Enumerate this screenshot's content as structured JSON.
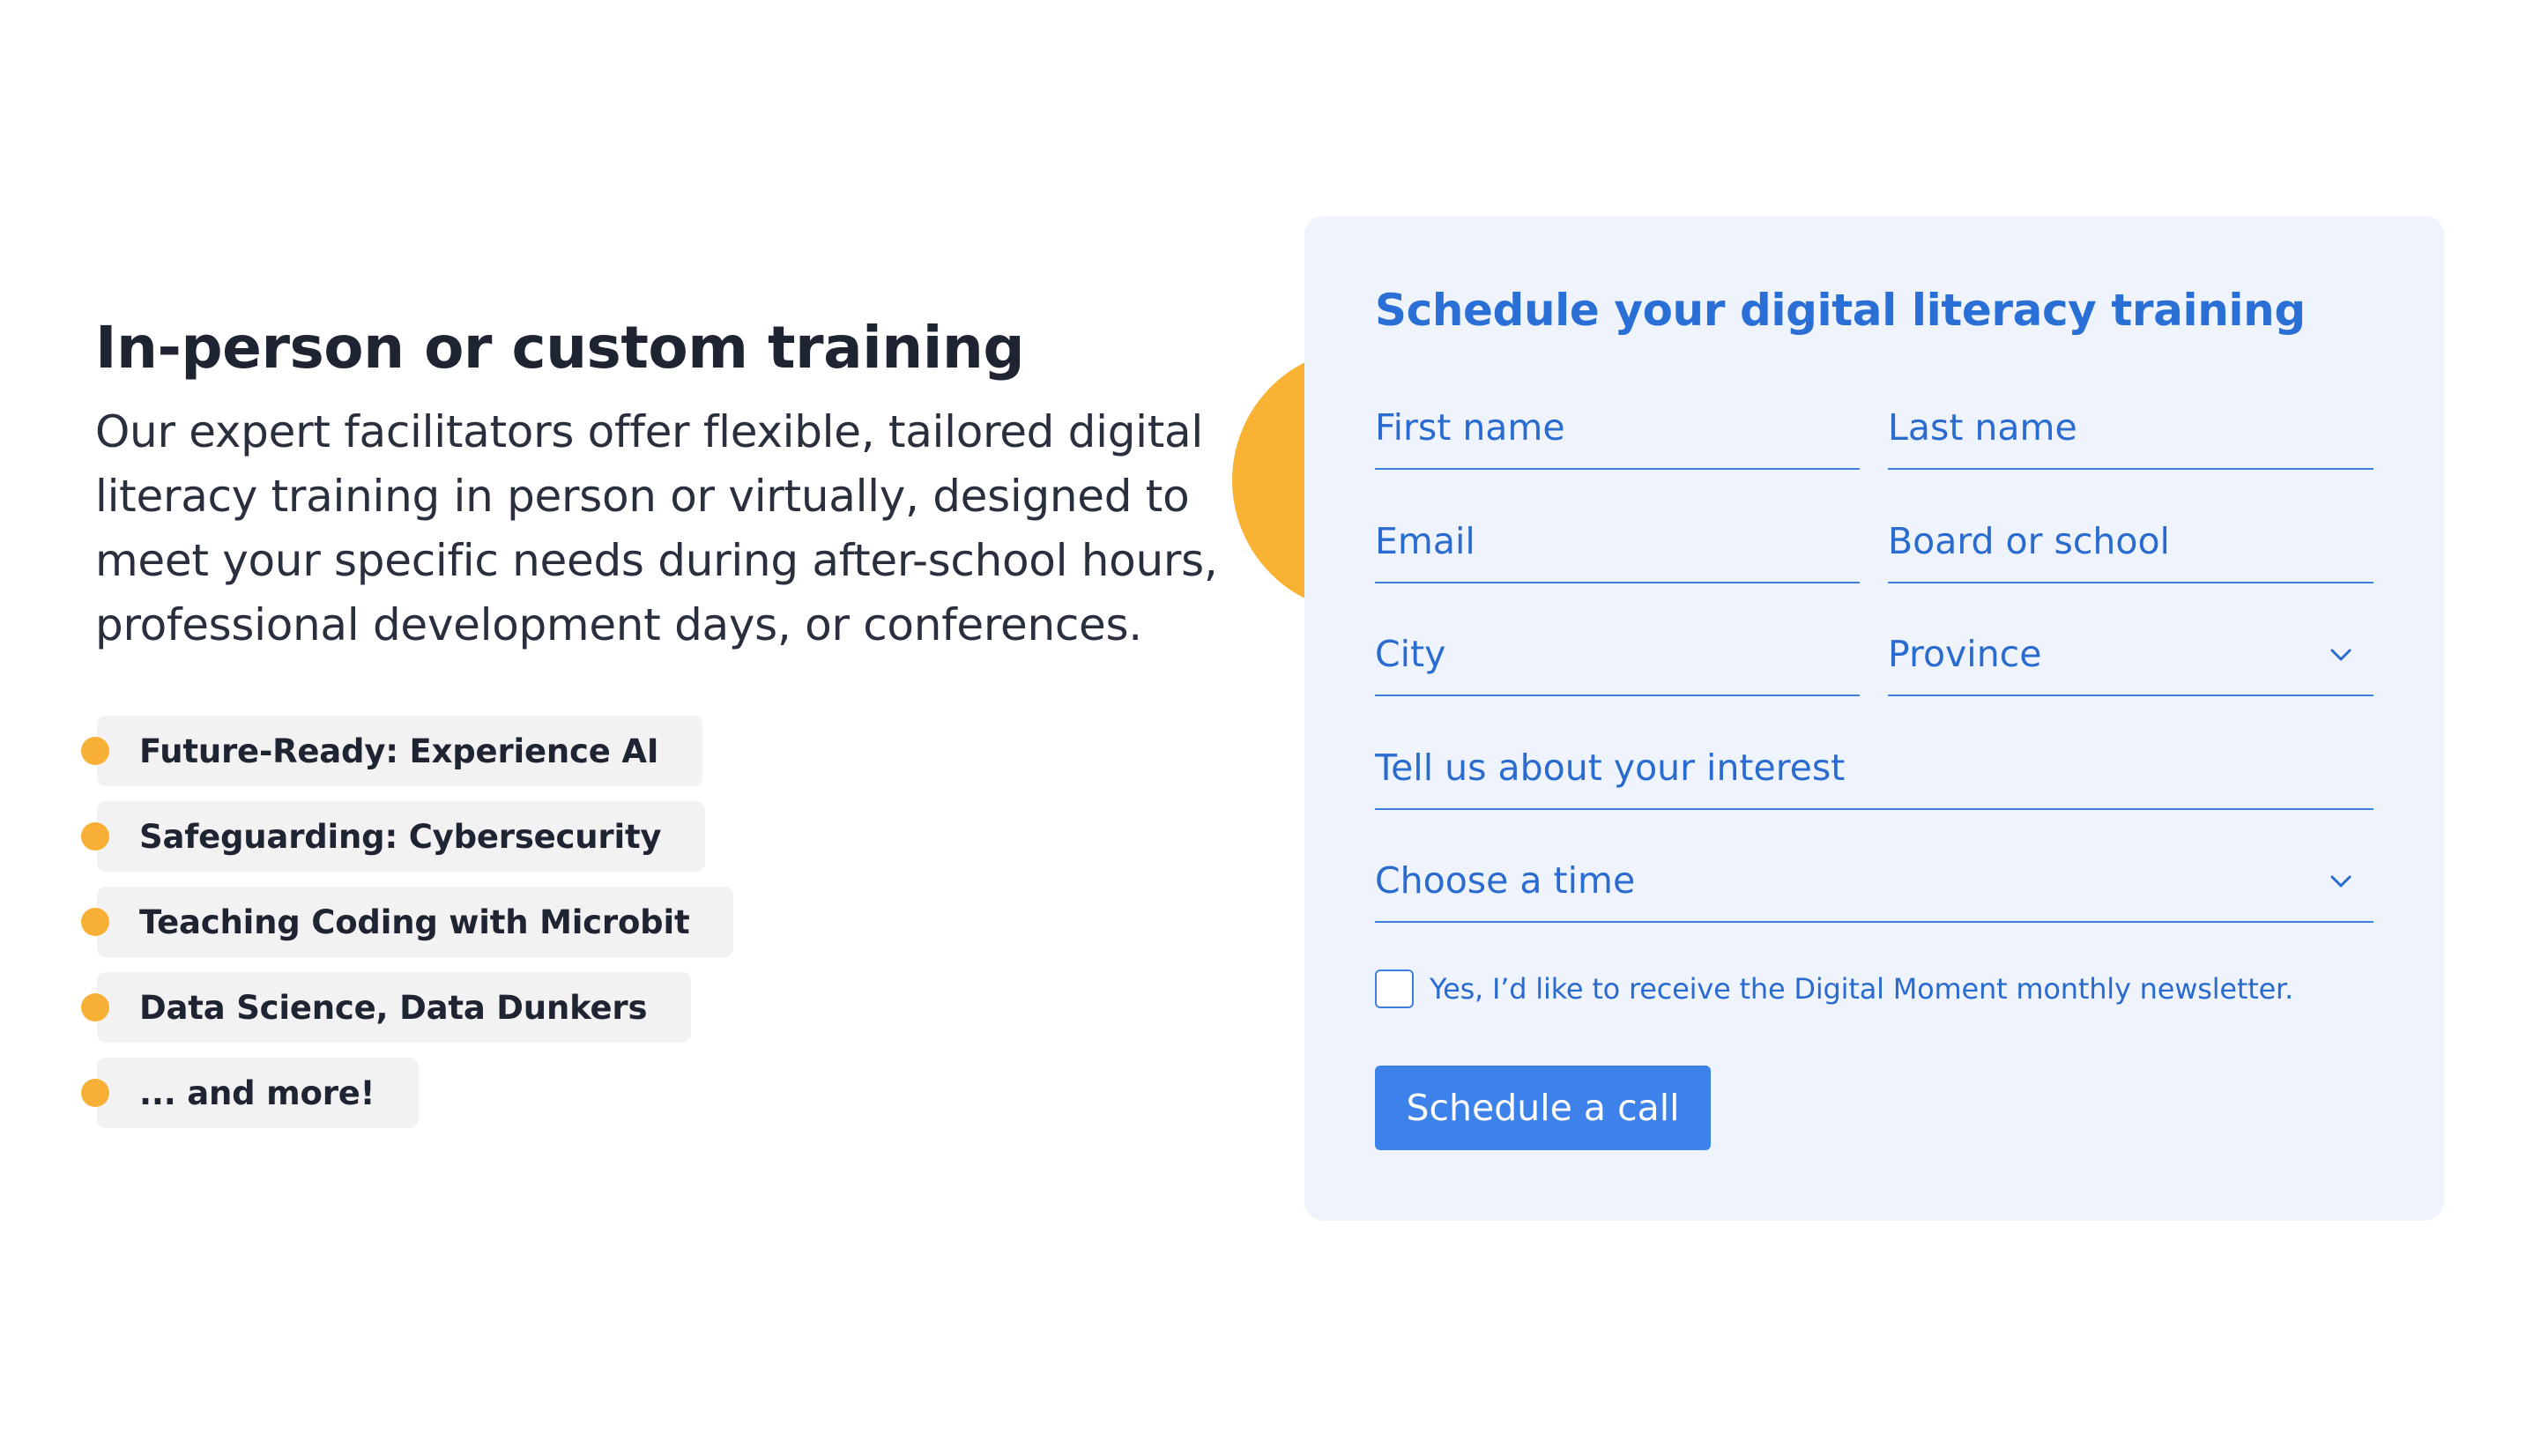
{
  "intro": {
    "heading": "In-person or custom training",
    "description": "Our expert facilitators offer flexible, tailored digital literacy training in person or virtually, designed to meet your specific needs during after-school hours, professional development days, or conferences."
  },
  "topics": [
    {
      "label": "Future-Ready: Experience AI"
    },
    {
      "label": "Safeguarding: Cybersecurity"
    },
    {
      "label": "Teaching Coding with Microbit"
    },
    {
      "label": "Data Science, Data Dunkers"
    },
    {
      "label": "... and more!"
    }
  ],
  "form": {
    "title": "Schedule your digital literacy training",
    "first_name_placeholder": "First name",
    "last_name_placeholder": "Last name",
    "email_placeholder": "Email",
    "board_placeholder": "Board or school",
    "city_placeholder": "City",
    "province_label": "Province",
    "interest_placeholder": "Tell us about your interest",
    "time_label": "Choose a time",
    "newsletter_label": "Yes, I’d like to receive the Digital Moment monthly newsletter.",
    "newsletter_checked": false,
    "submit_label": "Schedule a call"
  },
  "colors": {
    "accent_blue": "#3c82ea",
    "title_blue": "#2a6fd6",
    "bullet_yellow": "#f7b035",
    "card_background": "#eef3fc"
  },
  "icons": {
    "province_dropdown": "chevron-down-icon",
    "time_dropdown": "chevron-down-icon"
  }
}
